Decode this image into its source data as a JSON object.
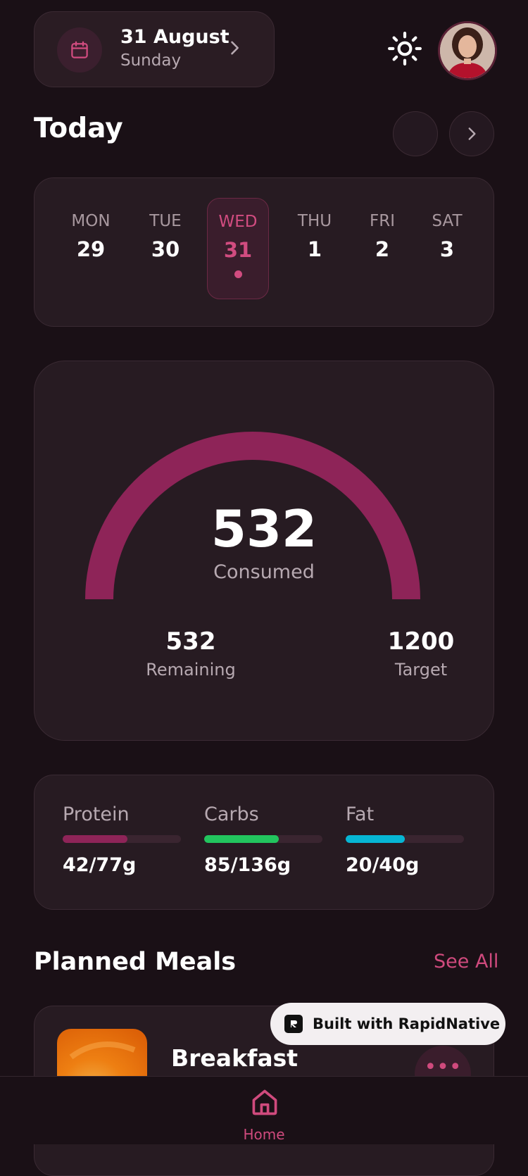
{
  "header": {
    "date_title": "31 August",
    "date_subtitle": "Sunday"
  },
  "today_title": "Today",
  "week": [
    {
      "name": "MON",
      "num": "29",
      "selected": false
    },
    {
      "name": "TUE",
      "num": "30",
      "selected": false
    },
    {
      "name": "WED",
      "num": "31",
      "selected": true
    },
    {
      "name": "THU",
      "num": "1",
      "selected": false
    },
    {
      "name": "FRI",
      "num": "2",
      "selected": false
    },
    {
      "name": "SAT",
      "num": "3",
      "selected": false
    }
  ],
  "calories": {
    "consumed_value": "532",
    "consumed_label": "Consumed",
    "remaining_value": "532",
    "remaining_label": "Remaining",
    "target_value": "1200",
    "target_label": "Target",
    "gauge_color": "#8e2458"
  },
  "macros": [
    {
      "label": "Protein",
      "value": "42/77g",
      "fraction": 0.55,
      "color": "#8e2458"
    },
    {
      "label": "Carbs",
      "value": "85/136g",
      "fraction": 0.63,
      "color": "#22c55e"
    },
    {
      "label": "Fat",
      "value": "20/40g",
      "fraction": 0.5,
      "color": "#06b6d4"
    }
  ],
  "planned": {
    "title": "Planned Meals",
    "see_all": "See All",
    "meals": [
      {
        "title": "Breakfast"
      }
    ]
  },
  "badge": {
    "text": "Built with RapidNative"
  },
  "nav": {
    "home_label": "Home"
  },
  "colors": {
    "accent": "#cf4a7d",
    "background": "#1a1016",
    "card": "#271b22"
  }
}
